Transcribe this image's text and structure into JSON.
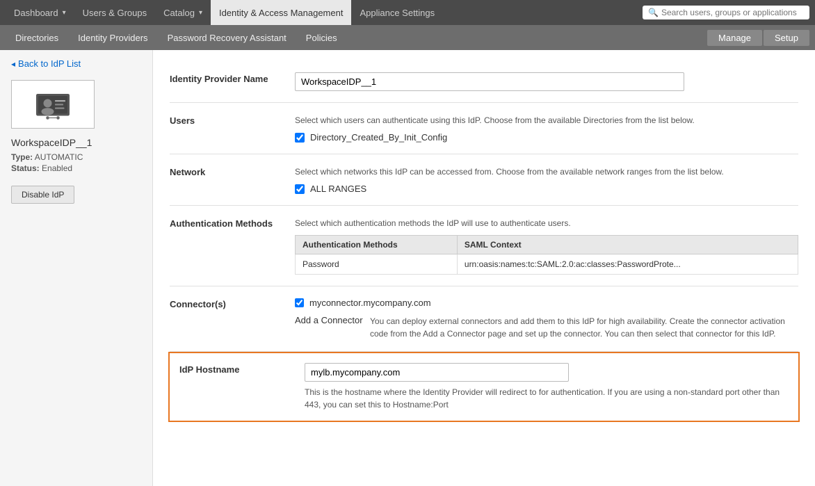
{
  "topNav": {
    "buttons": [
      {
        "id": "dashboard",
        "label": "Dashboard",
        "hasDropdown": true,
        "active": false
      },
      {
        "id": "users-groups",
        "label": "Users & Groups",
        "hasDropdown": false,
        "active": false
      },
      {
        "id": "catalog",
        "label": "Catalog",
        "hasDropdown": true,
        "active": false
      },
      {
        "id": "identity-access",
        "label": "Identity & Access Management",
        "hasDropdown": false,
        "active": true
      },
      {
        "id": "appliance-settings",
        "label": "Appliance Settings",
        "hasDropdown": false,
        "active": false
      }
    ],
    "search": {
      "placeholder": "Search users, groups or applications"
    }
  },
  "secondNav": {
    "items": [
      {
        "id": "directories",
        "label": "Directories"
      },
      {
        "id": "identity-providers",
        "label": "Identity Providers"
      },
      {
        "id": "password-recovery",
        "label": "Password Recovery Assistant"
      },
      {
        "id": "policies",
        "label": "Policies"
      }
    ],
    "rightButtons": [
      {
        "id": "manage",
        "label": "Manage"
      },
      {
        "id": "setup",
        "label": "Setup"
      }
    ]
  },
  "leftPanel": {
    "backLink": "Back to IdP List",
    "idpName": "WorkspaceIDP__1",
    "typeLabel": "Type:",
    "typeValue": "AUTOMATIC",
    "statusLabel": "Status:",
    "statusValue": "Enabled",
    "disableButton": "Disable IdP"
  },
  "mainPanel": {
    "fields": {
      "identityProviderName": {
        "label": "Identity Provider Name",
        "value": "WorkspaceIDP__1"
      },
      "users": {
        "label": "Users",
        "description": "Select which users can authenticate using this IdP. Choose from the available Directories from the list below.",
        "checkboxLabel": "Directory_Created_By_Init_Config",
        "checked": true
      },
      "network": {
        "label": "Network",
        "description": "Select which networks this IdP can be accessed from. Choose from the available network ranges from the list below.",
        "checkboxLabel": "ALL RANGES",
        "checked": true
      },
      "authMethods": {
        "label": "Authentication Methods",
        "description": "Select which authentication methods the IdP will use to authenticate users.",
        "tableHeaders": [
          "Authentication Methods",
          "SAML Context"
        ],
        "tableRows": [
          {
            "method": "Password",
            "saml": "urn:oasis:names:tc:SAML:2.0:ac:classes:PasswordProte..."
          }
        ]
      },
      "connectors": {
        "label": "Connector(s)",
        "connectorName": "myconnector.mycompany.com",
        "checked": true,
        "addConnectorLabel": "Add a Connector",
        "addConnectorDesc": "You can deploy external connectors and add them to this IdP for high availability. Create the connector activation code from the Add a Connector page and set up the connector. You can then select that connector for this IdP."
      },
      "idpHostname": {
        "label": "IdP Hostname",
        "value": "mylb.mycompany.com",
        "description": "This is the hostname where the Identity Provider will redirect to for authentication. If you are using a non-standard port other than 443, you can set this to Hostname:Port"
      }
    }
  }
}
